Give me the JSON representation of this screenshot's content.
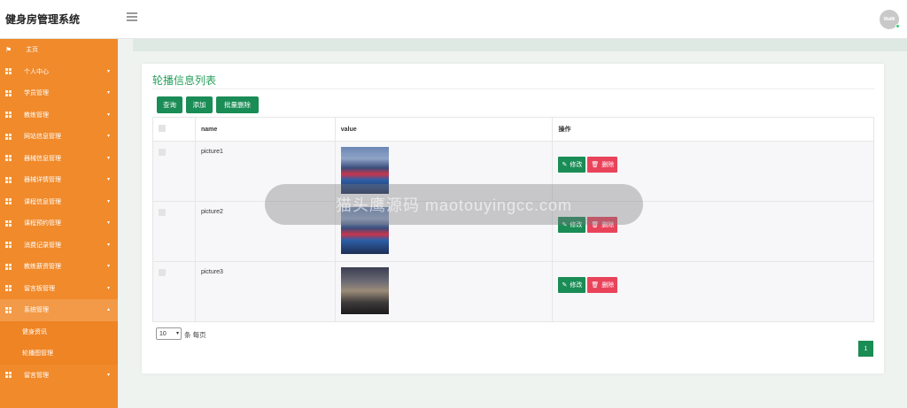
{
  "app": {
    "title": "健身房管理系统",
    "avatar_text": "WaMi"
  },
  "sidebar": {
    "home": "主页",
    "items": [
      {
        "label": "个人中心"
      },
      {
        "label": "学员管理"
      },
      {
        "label": "教练管理"
      },
      {
        "label": "网站信息管理"
      },
      {
        "label": "器械信息管理"
      },
      {
        "label": "器械详情管理"
      },
      {
        "label": "课程信息管理"
      },
      {
        "label": "课程预约管理"
      },
      {
        "label": "消费记录管理"
      },
      {
        "label": "教练薪资管理"
      },
      {
        "label": "留言板管理"
      },
      {
        "label": "系统管理"
      }
    ],
    "sub_items": [
      {
        "label": "健身资讯"
      },
      {
        "label": "轮播图管理"
      }
    ],
    "last_item": "留言管理"
  },
  "page": {
    "title": "轮播信息列表",
    "buttons": {
      "query": "查询",
      "add": "添加",
      "batch_delete": "批量删除"
    },
    "table": {
      "headers": {
        "name": "name",
        "value": "value",
        "ops": "操作"
      },
      "rows": [
        {
          "name": "picture1",
          "edit": "修改",
          "delete": "删除"
        },
        {
          "name": "picture2",
          "edit": "修改",
          "delete": "删除"
        },
        {
          "name": "picture3",
          "edit": "修改",
          "delete": "删除"
        }
      ]
    },
    "pager": {
      "page_size": "10",
      "per_page_text": "条 每页",
      "current_page": "1"
    }
  },
  "overlay_text": "猫头鹰源码 maotouyingcc.com",
  "colors": {
    "sidebar": "#f08a2b",
    "primary": "#1a8c55",
    "danger": "#e9435a",
    "title_green": "#27a05c"
  }
}
